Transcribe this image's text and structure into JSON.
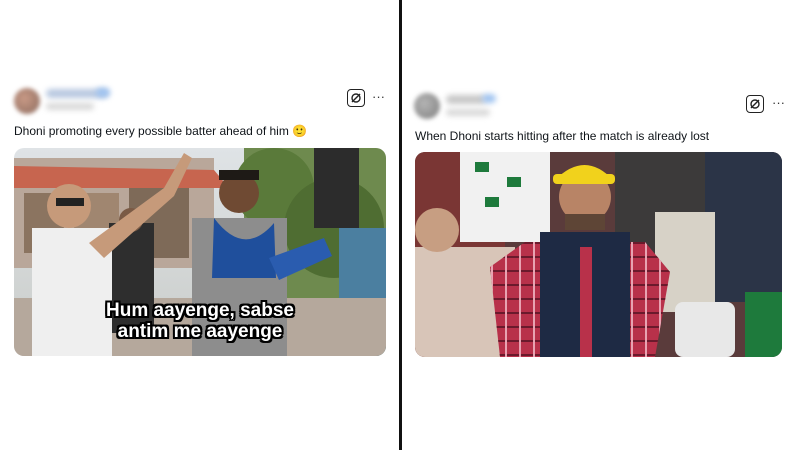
{
  "left_post": {
    "text": "Dhoni promoting every possible batter ahead of him",
    "emoji": "🙂",
    "more_label": "···",
    "meme_caption_line1": "Hum aayenge, sabse",
    "meme_caption_line2": "antim me aayenge"
  },
  "right_post": {
    "text": "When Dhoni starts hitting after the match is already lost",
    "more_label": "···"
  },
  "colors": {
    "divider": "#111111",
    "cap_yellow": "#f1d21c",
    "checked_shirt": "#b8314a",
    "pakistan_green": "#1e7a3c"
  },
  "icons": [
    "grok-icon",
    "more-icon"
  ]
}
